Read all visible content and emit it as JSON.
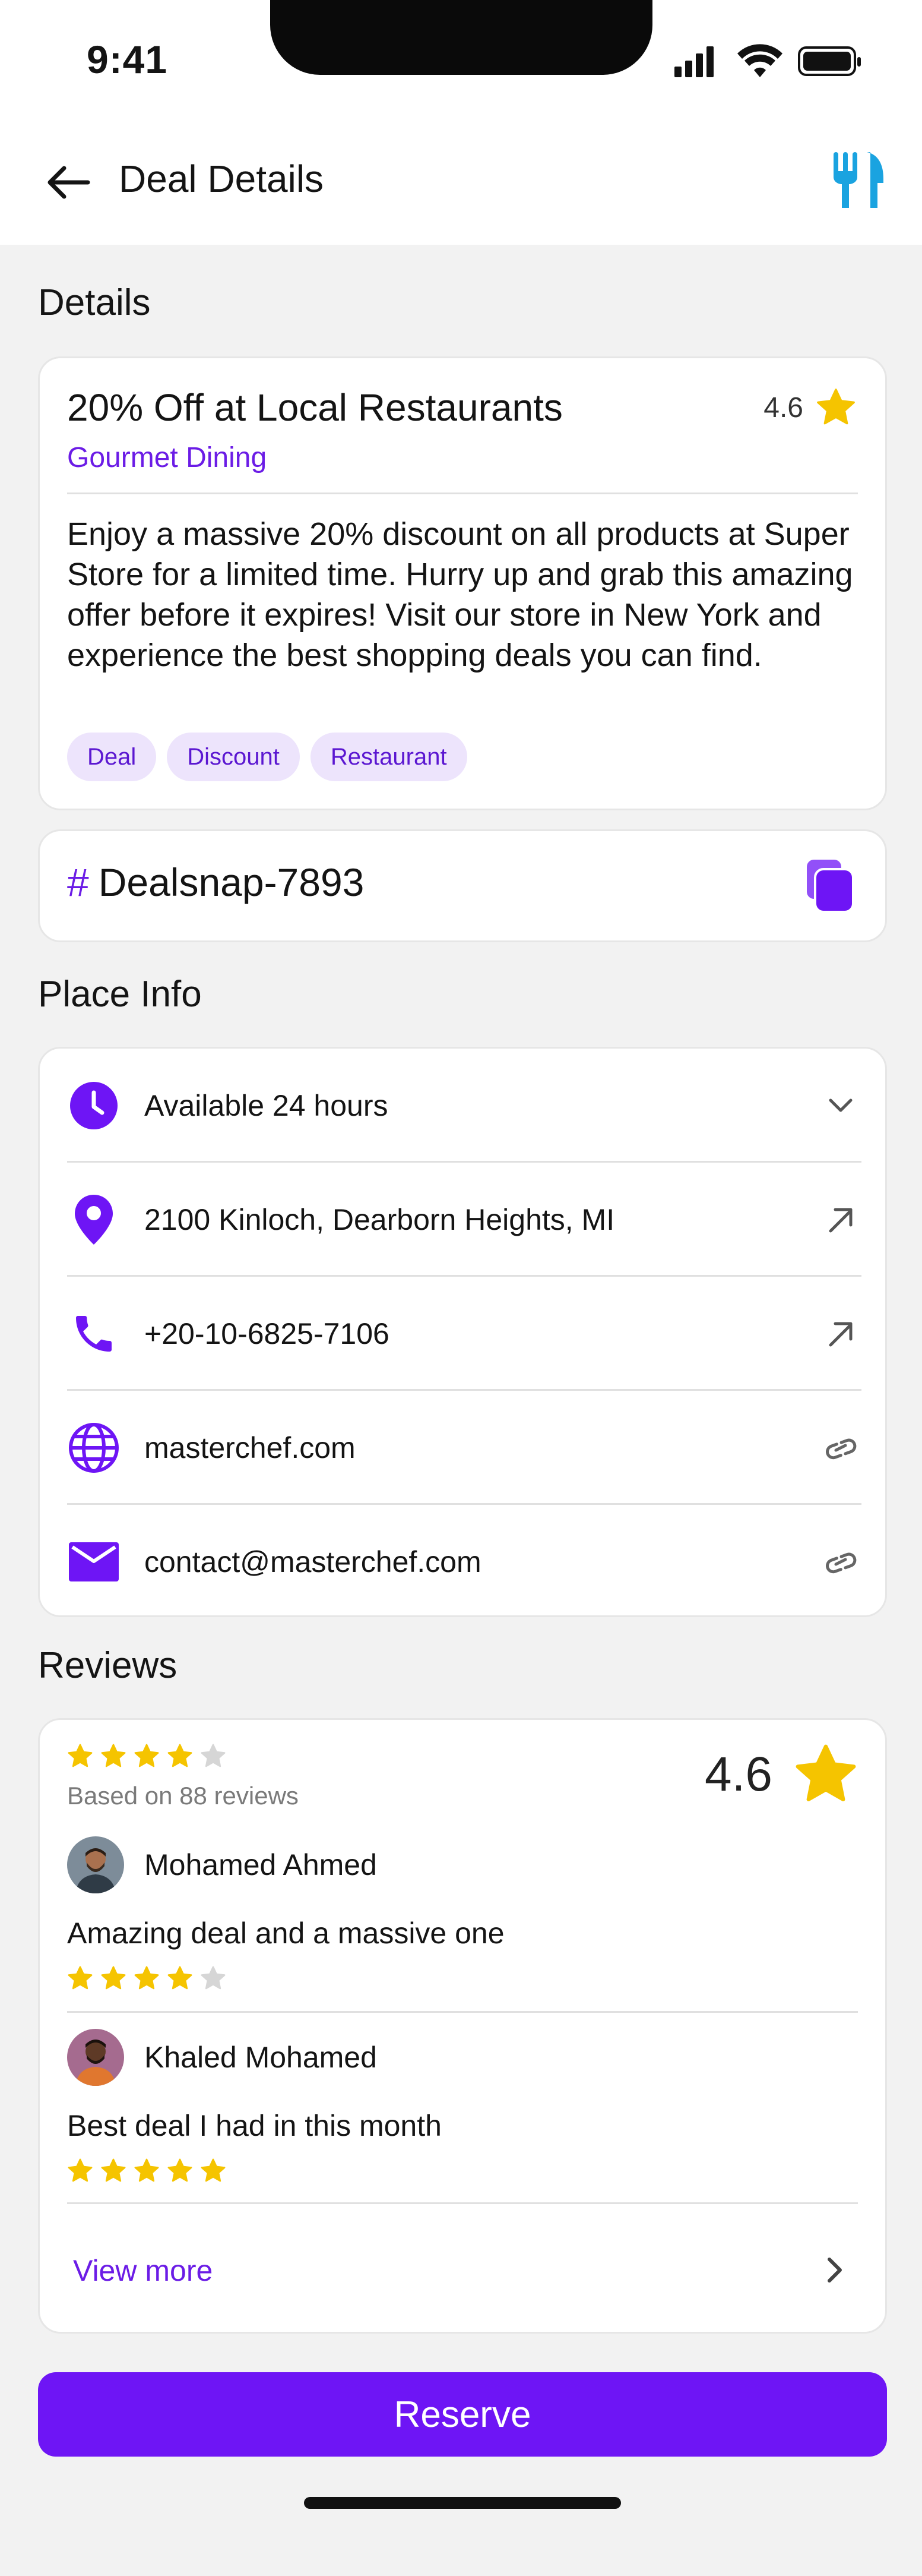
{
  "status_bar": {
    "time": "9:41"
  },
  "header": {
    "title": "Deal Details"
  },
  "details": {
    "section_title": "Details",
    "deal_title": "20% Off at Local Restaurants",
    "rating": "4.6",
    "category": "Gourmet Dining",
    "description": "Enjoy a massive 20% discount on all products at Super Store for a limited time. Hurry up and grab this amazing offer before it expires! Visit our store in New York and experience the best shopping deals you can find.",
    "tags": [
      "Deal",
      "Discount",
      "Restaurant"
    ]
  },
  "code": {
    "hash": "#",
    "value": "Dealsnap-7893"
  },
  "place_info": {
    "section_title": "Place Info",
    "rows": [
      {
        "icon": "clock-icon",
        "label": "Available 24 hours",
        "action": "chevron-down-icon"
      },
      {
        "icon": "location-pin-icon",
        "label": "2100 Kinloch, Dearborn Heights, MI",
        "action": "arrow-up-right-icon"
      },
      {
        "icon": "phone-icon",
        "label": "+20-10-6825-7106",
        "action": "arrow-up-right-icon"
      },
      {
        "icon": "globe-icon",
        "label": "masterchef.com",
        "action": "link-icon"
      },
      {
        "icon": "mail-icon",
        "label": "contact@masterchef.com",
        "action": "link-icon"
      }
    ]
  },
  "reviews": {
    "section_title": "Reviews",
    "summary_stars": 4,
    "based_on": "Based on 88 reviews",
    "rating": "4.6",
    "items": [
      {
        "name": "Mohamed Ahmed",
        "text": "Amazing deal and a massive one",
        "stars": 4
      },
      {
        "name": "Khaled Mohamed",
        "text": "Best deal I had in this month",
        "stars": 5
      }
    ],
    "view_more": "View more"
  },
  "reserve_label": "Reserve",
  "colors": {
    "accent": "#6e15f5",
    "brand_purple": "#6b1ce6",
    "star": "#f5c400",
    "cutlery": "#1aa3e0"
  }
}
